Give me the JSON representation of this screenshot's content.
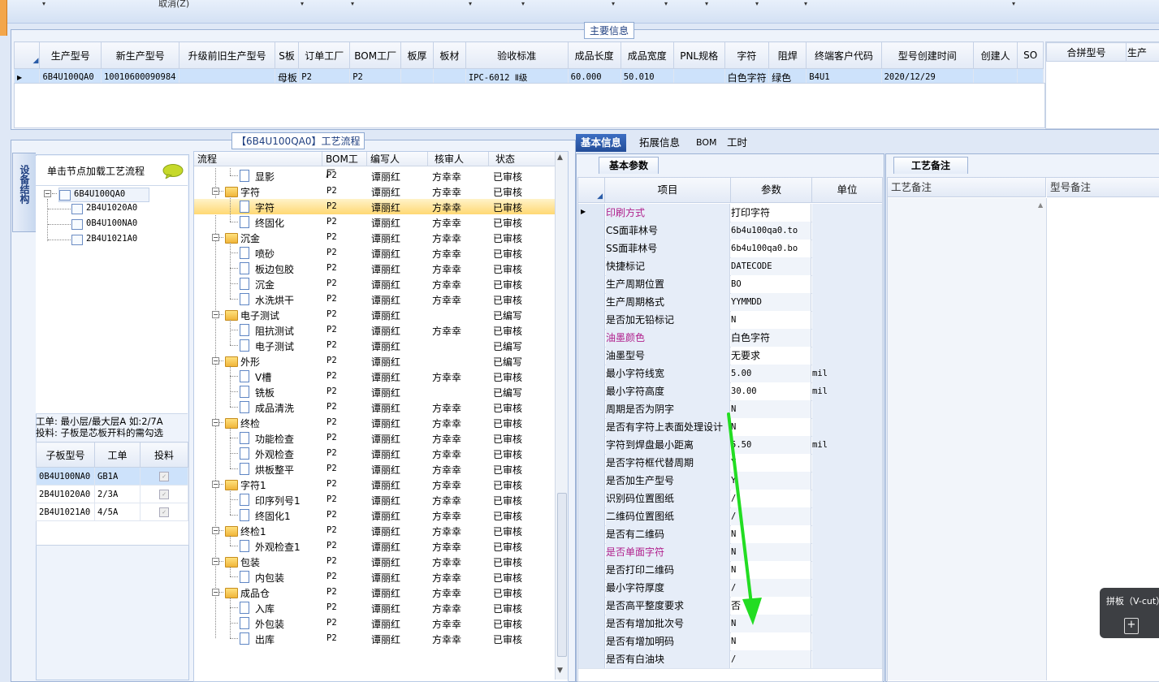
{
  "toolbar": {
    "cancel_label": "取消(Z)"
  },
  "main_info": {
    "title": "主要信息",
    "columns": [
      "生产型号",
      "新生产型号",
      "升级前旧生产型号",
      "S板",
      "订单工厂",
      "BOM工厂",
      "板厚",
      "板材",
      "验收标准",
      "成品长度",
      "成品宽度",
      "PNL规格",
      "字符",
      "阻焊",
      "终端客户代码",
      "型号创建时间",
      "创建人",
      "SO"
    ],
    "row": [
      "6B4U100QA0",
      "10010600090984",
      "",
      "母板",
      "P2",
      "P2",
      "",
      "",
      "IPC-6012 Ⅱ级",
      "60.000",
      "50.010",
      "",
      "白色字符",
      "绿色",
      "B4U1",
      "2020/12/29",
      "",
      ""
    ],
    "merge_columns": [
      "合拼型号",
      "生产"
    ]
  },
  "left": {
    "title": "【6B4U100QA0】工艺流程",
    "vertical_tab": "设备结构",
    "tree_hint": "单击节点加载工艺流程",
    "tree": {
      "root": "6B4U100QA0",
      "children": [
        "2B4U1020A0",
        "0B4U100NA0",
        "2B4U1021A0"
      ]
    },
    "note_line1": "工单: 最小层/最大层A 如:2/7A",
    "note_line2": "投料: 子板是芯板开料的需勾选",
    "sub_grid": {
      "columns": [
        "子板型号",
        "工单",
        "投料"
      ],
      "rows": [
        {
          "model": "0B4U100NA0",
          "order": "GB1A",
          "check": "✓"
        },
        {
          "model": "2B4U1020A0",
          "order": "2/3A",
          "check": "✓"
        },
        {
          "model": "2B4U1021A0",
          "order": "4/5A",
          "check": "✓"
        }
      ]
    }
  },
  "process": {
    "columns": [
      "流程",
      "BOM工厂",
      "编写人",
      "核审人",
      "状态"
    ],
    "rows": [
      {
        "name": "显影",
        "type": "doc",
        "bom": "P2",
        "writer": "谭丽红",
        "reviewer": "方幸幸",
        "status": "已审核"
      },
      {
        "name": "字符",
        "type": "folder",
        "bom": "P2",
        "writer": "谭丽红",
        "reviewer": "方幸幸",
        "status": "已审核"
      },
      {
        "name": "字符",
        "type": "doc",
        "bom": "P2",
        "writer": "谭丽红",
        "reviewer": "方幸幸",
        "status": "已审核",
        "selected": true
      },
      {
        "name": "终固化",
        "type": "doc",
        "bom": "P2",
        "writer": "谭丽红",
        "reviewer": "方幸幸",
        "status": "已审核"
      },
      {
        "name": "沉金",
        "type": "folder",
        "bom": "P2",
        "writer": "谭丽红",
        "reviewer": "方幸幸",
        "status": "已审核"
      },
      {
        "name": "喷砂",
        "type": "doc",
        "bom": "P2",
        "writer": "谭丽红",
        "reviewer": "方幸幸",
        "status": "已审核"
      },
      {
        "name": "板边包胶",
        "type": "doc",
        "bom": "P2",
        "writer": "谭丽红",
        "reviewer": "方幸幸",
        "status": "已审核"
      },
      {
        "name": "沉金",
        "type": "doc",
        "bom": "P2",
        "writer": "谭丽红",
        "reviewer": "方幸幸",
        "status": "已审核"
      },
      {
        "name": "水洗烘干",
        "type": "doc",
        "bom": "P2",
        "writer": "谭丽红",
        "reviewer": "方幸幸",
        "status": "已审核"
      },
      {
        "name": "电子测试",
        "type": "folder",
        "bom": "P2",
        "writer": "谭丽红",
        "reviewer": "",
        "status": "已编写"
      },
      {
        "name": "阻抗测试",
        "type": "doc",
        "bom": "P2",
        "writer": "谭丽红",
        "reviewer": "方幸幸",
        "status": "已审核"
      },
      {
        "name": "电子测试",
        "type": "doc",
        "bom": "P2",
        "writer": "谭丽红",
        "reviewer": "",
        "status": "已编写"
      },
      {
        "name": "外形",
        "type": "folder",
        "bom": "P2",
        "writer": "谭丽红",
        "reviewer": "",
        "status": "已编写"
      },
      {
        "name": "V槽",
        "type": "doc",
        "bom": "P2",
        "writer": "谭丽红",
        "reviewer": "方幸幸",
        "status": "已审核"
      },
      {
        "name": "铣板",
        "type": "doc",
        "bom": "P2",
        "writer": "谭丽红",
        "reviewer": "",
        "status": "已编写"
      },
      {
        "name": "成品清洗",
        "type": "doc",
        "bom": "P2",
        "writer": "谭丽红",
        "reviewer": "方幸幸",
        "status": "已审核"
      },
      {
        "name": "终检",
        "type": "folder",
        "bom": "P2",
        "writer": "谭丽红",
        "reviewer": "方幸幸",
        "status": "已审核"
      },
      {
        "name": "功能检查",
        "type": "doc",
        "bom": "P2",
        "writer": "谭丽红",
        "reviewer": "方幸幸",
        "status": "已审核"
      },
      {
        "name": "外观检查",
        "type": "doc",
        "bom": "P2",
        "writer": "谭丽红",
        "reviewer": "方幸幸",
        "status": "已审核"
      },
      {
        "name": "烘板整平",
        "type": "doc",
        "bom": "P2",
        "writer": "谭丽红",
        "reviewer": "方幸幸",
        "status": "已审核"
      },
      {
        "name": "字符1",
        "type": "folder",
        "bom": "P2",
        "writer": "谭丽红",
        "reviewer": "方幸幸",
        "status": "已审核"
      },
      {
        "name": "印序列号1",
        "type": "doc",
        "bom": "P2",
        "writer": "谭丽红",
        "reviewer": "方幸幸",
        "status": "已审核"
      },
      {
        "name": "终固化1",
        "type": "doc",
        "bom": "P2",
        "writer": "谭丽红",
        "reviewer": "方幸幸",
        "status": "已审核"
      },
      {
        "name": "终检1",
        "type": "folder",
        "bom": "P2",
        "writer": "谭丽红",
        "reviewer": "方幸幸",
        "status": "已审核"
      },
      {
        "name": "外观检查1",
        "type": "doc",
        "bom": "P2",
        "writer": "谭丽红",
        "reviewer": "方幸幸",
        "status": "已审核"
      },
      {
        "name": "包装",
        "type": "folder",
        "bom": "P2",
        "writer": "谭丽红",
        "reviewer": "方幸幸",
        "status": "已审核"
      },
      {
        "name": "内包装",
        "type": "doc",
        "bom": "P2",
        "writer": "谭丽红",
        "reviewer": "方幸幸",
        "status": "已审核"
      },
      {
        "name": "成品仓",
        "type": "folder",
        "bom": "P2",
        "writer": "谭丽红",
        "reviewer": "方幸幸",
        "status": "已审核"
      },
      {
        "name": "入库",
        "type": "doc",
        "bom": "P2",
        "writer": "谭丽红",
        "reviewer": "方幸幸",
        "status": "已审核"
      },
      {
        "name": "外包装",
        "type": "doc",
        "bom": "P2",
        "writer": "谭丽红",
        "reviewer": "方幸幸",
        "status": "已审核"
      },
      {
        "name": "出库",
        "type": "doc",
        "bom": "P2",
        "writer": "谭丽红",
        "reviewer": "方幸幸",
        "status": "已审核"
      }
    ]
  },
  "right_tabs": [
    "基本信息",
    "拓展信息",
    "BOM",
    "工时"
  ],
  "basic": {
    "subtab": "基本参数",
    "columns": [
      "项目",
      "参数",
      "单位"
    ],
    "rows": [
      {
        "item": "印刷方式",
        "value": "打印字符",
        "unit": "",
        "hl": true,
        "mono": false
      },
      {
        "item": "CS面菲林号",
        "value": "6b4u100qa0.to",
        "unit": "",
        "hl": false,
        "mono": true
      },
      {
        "item": "SS面菲林号",
        "value": "6b4u100qa0.bo",
        "unit": "",
        "hl": false,
        "mono": true
      },
      {
        "item": "快捷标记",
        "value": "DATECODE",
        "unit": "",
        "hl": false,
        "mono": true
      },
      {
        "item": "生产周期位置",
        "value": "BO",
        "unit": "",
        "hl": false,
        "mono": true
      },
      {
        "item": "生产周期格式",
        "value": "YYMMDD",
        "unit": "",
        "hl": false,
        "mono": true
      },
      {
        "item": "是否加无铅标记",
        "value": "N",
        "unit": "",
        "hl": false,
        "mono": true
      },
      {
        "item": "油墨颜色",
        "value": "白色字符",
        "unit": "",
        "hl": true,
        "mono": false
      },
      {
        "item": "油墨型号",
        "value": "无要求",
        "unit": "",
        "hl": false,
        "mono": false
      },
      {
        "item": "最小字符线宽",
        "value": "5.00",
        "unit": "mil",
        "hl": false,
        "mono": true
      },
      {
        "item": "最小字符高度",
        "value": "30.00",
        "unit": "mil",
        "hl": false,
        "mono": true
      },
      {
        "item": "周期是否为阴字",
        "value": "N",
        "unit": "",
        "hl": false,
        "mono": true
      },
      {
        "item": "是否有字符上表面处理设计",
        "value": "N",
        "unit": "",
        "hl": false,
        "mono": true
      },
      {
        "item": "字符到焊盘最小距离",
        "value": "5.50",
        "unit": "mil",
        "hl": false,
        "mono": true
      },
      {
        "item": "是否字符框代替周期",
        "value": "Y",
        "unit": "",
        "hl": false,
        "mono": true
      },
      {
        "item": "是否加生产型号",
        "value": "Y",
        "unit": "",
        "hl": false,
        "mono": true
      },
      {
        "item": "识别码位置图纸",
        "value": "/",
        "unit": "",
        "hl": false,
        "mono": true
      },
      {
        "item": "二维码位置图纸",
        "value": "/",
        "unit": "",
        "hl": false,
        "mono": true
      },
      {
        "item": "是否有二维码",
        "value": "N",
        "unit": "",
        "hl": false,
        "mono": true
      },
      {
        "item": "是否单面字符",
        "value": "N",
        "unit": "",
        "hl": true,
        "mono": true
      },
      {
        "item": "是否打印二维码",
        "value": "N",
        "unit": "",
        "hl": false,
        "mono": true
      },
      {
        "item": "最小字符厚度",
        "value": "/",
        "unit": "",
        "hl": false,
        "mono": true
      },
      {
        "item": "是否高平整度要求",
        "value": "否",
        "unit": "",
        "hl": false,
        "mono": false
      },
      {
        "item": "是否有增加批次号",
        "value": "N",
        "unit": "",
        "hl": false,
        "mono": true
      },
      {
        "item": "是否有增加明码",
        "value": "N",
        "unit": "",
        "hl": false,
        "mono": true
      },
      {
        "item": "是否有白油块",
        "value": "/",
        "unit": "",
        "hl": false,
        "mono": true
      }
    ]
  },
  "notes": {
    "tab": "工艺备注",
    "col1": "工艺备注",
    "col2": "型号备注"
  },
  "vcut": {
    "title": "拼板（V-cut）"
  },
  "colors": {
    "accent": "#234d98",
    "highlight_text": "#b0208c",
    "selected_row": "#ffd873",
    "arrow": "#22dd22"
  }
}
